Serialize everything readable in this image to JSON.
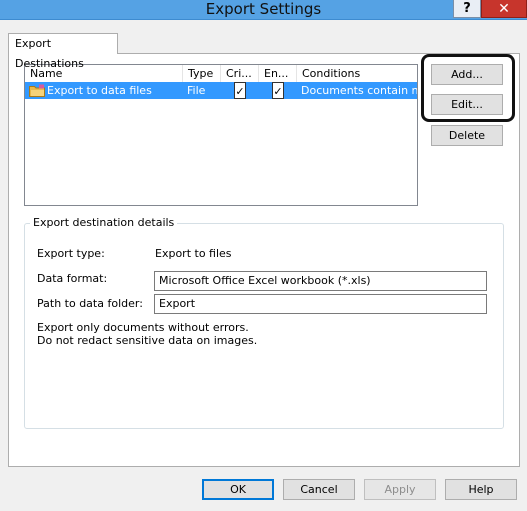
{
  "window": {
    "title": "Export Settings",
    "help_label": "?",
    "close_label": "✕"
  },
  "tab": {
    "label": "Export Destinations"
  },
  "list": {
    "columns": [
      "Name",
      "Type",
      "Cri...",
      "En...",
      "Conditions"
    ],
    "rows": [
      {
        "name": "Export to data files",
        "type": "File",
        "critical": true,
        "enabled": true,
        "conditions": "Documents contain n...",
        "selected": true,
        "icon": "folder-icon"
      }
    ]
  },
  "side_buttons": {
    "add": "Add...",
    "edit": "Edit...",
    "delete": "Delete"
  },
  "details": {
    "legend": "Export destination details",
    "export_type_label": "Export type:",
    "export_type_value": "Export to files",
    "data_format_label": "Data format:",
    "data_format_value": "Microsoft Office Excel workbook (*.xls)",
    "path_label": "Path to data folder:",
    "path_value": "Export",
    "note_line1": "Export only documents without errors.",
    "note_line2": "Do not redact sensitive data on images."
  },
  "footer": {
    "ok": "OK",
    "cancel": "Cancel",
    "apply": "Apply",
    "help": "Help"
  },
  "colors": {
    "titlebar": "#55a2e4",
    "selection": "#3399ff",
    "close": "#c7352c"
  }
}
